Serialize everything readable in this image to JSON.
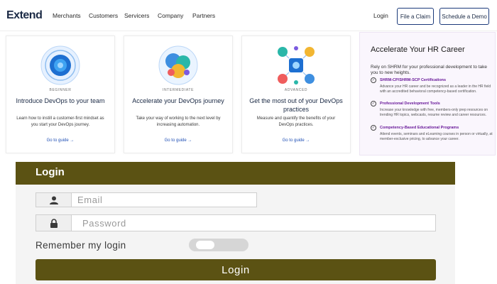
{
  "nav": {
    "logo": "Extend",
    "links": [
      "Merchants",
      "Customers",
      "Servicers",
      "Company",
      "Partners"
    ],
    "login": "Login",
    "file_claim": "File a Claim",
    "schedule_demo": "Schedule a Demo"
  },
  "cards": [
    {
      "level": "BEGINNER",
      "title": "Introduce DevOps to your team",
      "desc": "Learn how to instill a customer-first mindset as you start your DevOps journey.",
      "link": "Go to guide →"
    },
    {
      "level": "INTERMEDIATE",
      "title": "Accelerate your DevOps journey",
      "desc": "Take your way of working to the next level by increasing automation.",
      "link": "Go to guide →"
    },
    {
      "level": "ADVANCED",
      "title": "Get the most out of your DevOps practices",
      "desc": "Measure and quantify the benefits of your DevOps practices.",
      "link": "Go to guide →"
    }
  ],
  "ad": {
    "title": "Accelerate Your HR Career",
    "intro": "Rely on SHRM for your professional development to take you to new heights.",
    "items": [
      {
        "title": "SHRM-CP/SHRM-SCP Certifications",
        "desc": "Advance your HR career and be recognized as a leader in the HR field with an accredited behavioral competency-based certification."
      },
      {
        "title": "Professional Development Tools",
        "desc": "Increase your knowledge with free, members-only prep resources on trending HR topics, webcasts, resume review and career resources."
      },
      {
        "title": "Competency-Based Educational Programs",
        "desc": "Attend events, seminars and eLearning courses in person or virtually, at member-exclusive pricing, to advance your career."
      }
    ]
  },
  "login": {
    "title": "Login",
    "email_placeholder": "Email",
    "password_placeholder": "Password",
    "remember": "Remember my login",
    "remember_on": false,
    "button": "Login"
  },
  "colors": {
    "login_header": "#5b5213",
    "nav_button_border": "#1b3a7a",
    "ad_item_title": "#6a1b9a"
  }
}
